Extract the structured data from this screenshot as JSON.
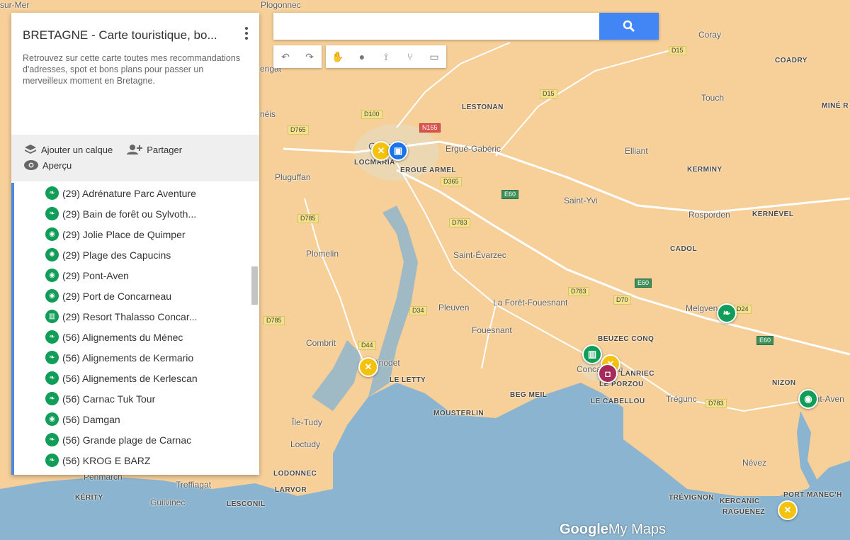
{
  "panel": {
    "title": "BRETAGNE - Carte touristique, bo...",
    "description": "Retrouvez sur cette carte toutes mes recommandations d'adresses, spot et bons plans pour passer un merveilleux moment en Bretagne.",
    "add_layer_label": "Ajouter un calque",
    "share_label": "Partager",
    "preview_label": "Aperçu",
    "items": [
      {
        "label": "(29) Adrénature Parc Aventure",
        "icon": "leaf-icon"
      },
      {
        "label": "(29) Bain de forêt ou Sylvoth...",
        "icon": "leaf-icon"
      },
      {
        "label": "(29) Jolie Place de Quimper",
        "icon": "camera-icon"
      },
      {
        "label": "(29) Plage des Capucins",
        "icon": "beach-icon"
      },
      {
        "label": "(29) Pont-Aven",
        "icon": "camera-icon"
      },
      {
        "label": "(29) Port de Concarneau",
        "icon": "camera-icon"
      },
      {
        "label": "(29) Resort Thalasso Concar...",
        "icon": "hotel-icon"
      },
      {
        "label": "(56) Alignements du Ménec",
        "icon": "leaf-icon"
      },
      {
        "label": "(56) Alignements de Kermario",
        "icon": "leaf-icon"
      },
      {
        "label": "(56) Alignements de Kerlescan",
        "icon": "leaf-icon"
      },
      {
        "label": "(56) Carnac Tuk Tour",
        "icon": "leaf-icon"
      },
      {
        "label": "(56) Damgan",
        "icon": "camera-icon"
      },
      {
        "label": "(56) Grande plage de Carnac",
        "icon": "leaf-icon"
      },
      {
        "label": "(56) KROG E BARZ",
        "icon": "leaf-icon"
      }
    ]
  },
  "search": {
    "placeholder": "",
    "value": ""
  },
  "brand": {
    "google": "Google",
    "mymaps": "My Maps"
  },
  "colors": {
    "land": "#f6cf99",
    "sea": "#8ab4cf",
    "accent": "#4285f4",
    "green": "#0f9d58",
    "yellow": "#f4c20d",
    "blue": "#1a73e8",
    "magenta": "#a52a5b"
  },
  "map_labels": {
    "plogonnec": "Plogonnec",
    "coray": "Coray",
    "coadry": "COADRY",
    "touch": "Touch",
    "mine_r": "MINÉ R",
    "lestonan": "LESTONAN",
    "ergue_gaberic": "Ergué-Gabéric",
    "elliant": "Elliant",
    "kerminy": "KERMINY",
    "locmaria": "LOCMARIA",
    "ergue_armel": "ERGUÉ ARMEL",
    "pluguffan": "Pluguffan",
    "saint_yvi": "Saint-Yvi",
    "rosporden": "Rosporden",
    "kernevel": "KERNÉVEL",
    "plomelin": "Plomelin",
    "saint_evarzec": "Saint-Évarzec",
    "cadol": "CADOL",
    "la_foret_fouesnant": "La Forêt-Fouesnant",
    "pleuven": "Pleuven",
    "melgven": "Melgven",
    "fouesnant": "Fouesnant",
    "beuzec_conq": "BEUZEC CONQ",
    "combrit": "Combrit",
    "benodet": "Bénodet",
    "le_letty": "LE LETTY",
    "concarneau": "Concarneau",
    "lanriec": "LANRIEC",
    "le_porzou": "LE PORZOU",
    "le_cabellou": "LE CABELLOU",
    "tregunc": "Trégunc",
    "nizon": "NIZON",
    "pont_aven": "Pont-Aven",
    "beg_meil": "BEG MEIL",
    "mousterlin": "MOUSTERLIN",
    "ile_tudy": "Île-Tudy",
    "loctudy": "Loctudy",
    "nevez": "Névez",
    "lodonnec": "LODONNEC",
    "larvor": "LARVOR",
    "penmarch": "Penmarch",
    "treffiagat": "Treffiagat",
    "kerity": "KÉRITY",
    "guilvinec": "Guilvinec",
    "lesconil": "LESCONIL",
    "trevignon": "TRÉVIGNON",
    "kercanic": "KERCANIC",
    "raguenez": "RAGUÉNEZ",
    "port_manech": "PORT MANEC'H",
    "quimper": "Quimper",
    "sur_mer": "sur-Mer",
    "engat": "engat",
    "neis": "néis"
  },
  "roads": {
    "d15a": "D15",
    "d15b": "D15",
    "d100": "D100",
    "n165": "N165",
    "d765": "D765",
    "d365": "D365",
    "e60a": "E60",
    "e60b": "E60",
    "e60c": "E60",
    "d785a": "D785",
    "d783a": "D783",
    "d783b": "D783",
    "d783c": "D783",
    "d70": "D70",
    "d34": "D34",
    "d785b": "D785",
    "d44": "D44",
    "d24": "D24"
  }
}
